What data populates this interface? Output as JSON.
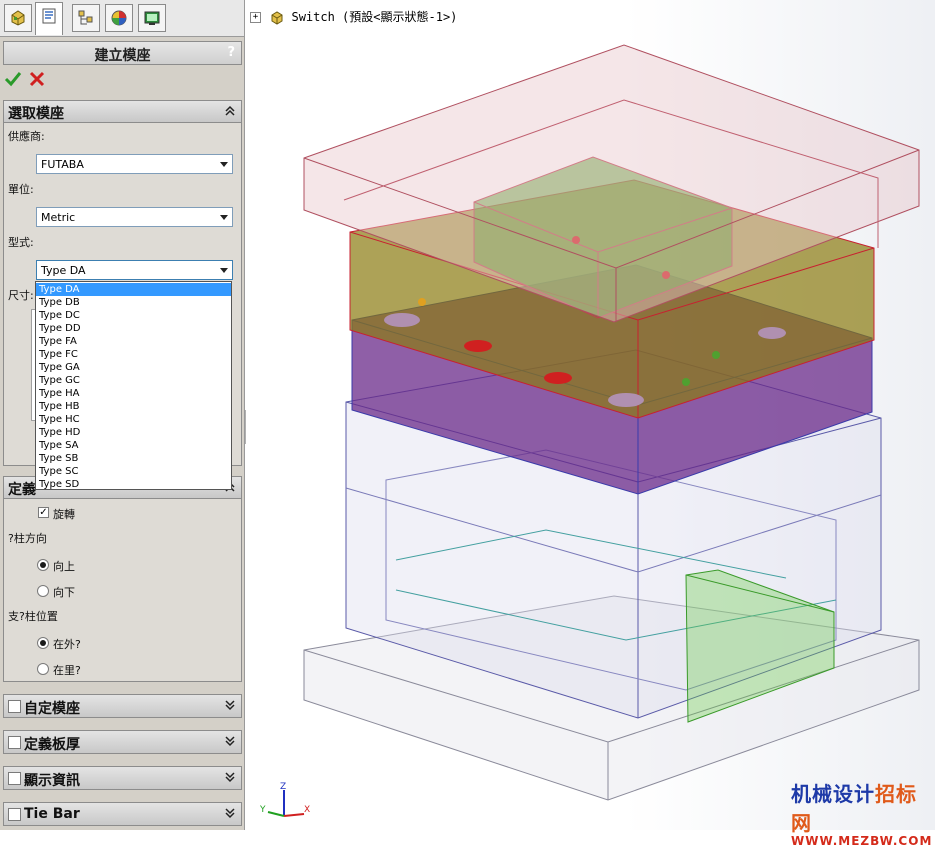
{
  "tabs": [
    {
      "icon": "feature-manager-icon"
    },
    {
      "icon": "property-manager-icon",
      "active": true
    },
    {
      "icon": "configuration-manager-icon"
    },
    {
      "icon": "appearance-icon"
    },
    {
      "icon": "display-manager-icon"
    }
  ],
  "panel": {
    "title": "建立模座",
    "help": "?",
    "confirm_icon": "checkmark-icon",
    "cancel_icon": "close-icon"
  },
  "select_group": {
    "title": "選取模座",
    "vendor_label": "供應商:",
    "vendor_value": "FUTABA",
    "unit_label": "單位:",
    "unit_value": "Metric",
    "type_label": "型式:",
    "type_value": "Type DA",
    "size_label": "尺寸:",
    "type_options": [
      "Type DA",
      "Type DB",
      "Type DC",
      "Type DD",
      "Type FA",
      "Type FC",
      "Type GA",
      "Type GC",
      "Type HA",
      "Type HB",
      "Type HC",
      "Type HD",
      "Type SA",
      "Type SB",
      "Type SC",
      "Type SD"
    ],
    "highlighted_option": "Type DA"
  },
  "define_group": {
    "title": "定義",
    "rotate_label": "旋轉",
    "rotate_checked": true,
    "pillar_dir_label": "?柱方向",
    "dir_up": "向上",
    "dir_down": "向下",
    "dir_selected": "up",
    "pillar_pos_label": "支?柱位置",
    "pos_outside": "在外?",
    "pos_inside": "在里?",
    "pos_selected": "outside"
  },
  "collapsed_groups": [
    "自定模座",
    "定義板厚",
    "顯示資訊",
    "Tie Bar"
  ],
  "tree": {
    "expand": "+",
    "label": "Switch  (預設<顯示狀態-1>)"
  },
  "triad": {
    "x": "X",
    "y": "Y",
    "z": "Z"
  },
  "watermark": {
    "line1_a": "机械设计",
    "line1_b": "招标网",
    "line2": "WWW.MEZBW.COM"
  },
  "colors": {
    "accent_select": "#3399ff",
    "plate_red": "#cc2233",
    "plate_blue": "#3344aa",
    "cavity_green": "#66aa33",
    "core_purple": "#6a2a8a"
  }
}
